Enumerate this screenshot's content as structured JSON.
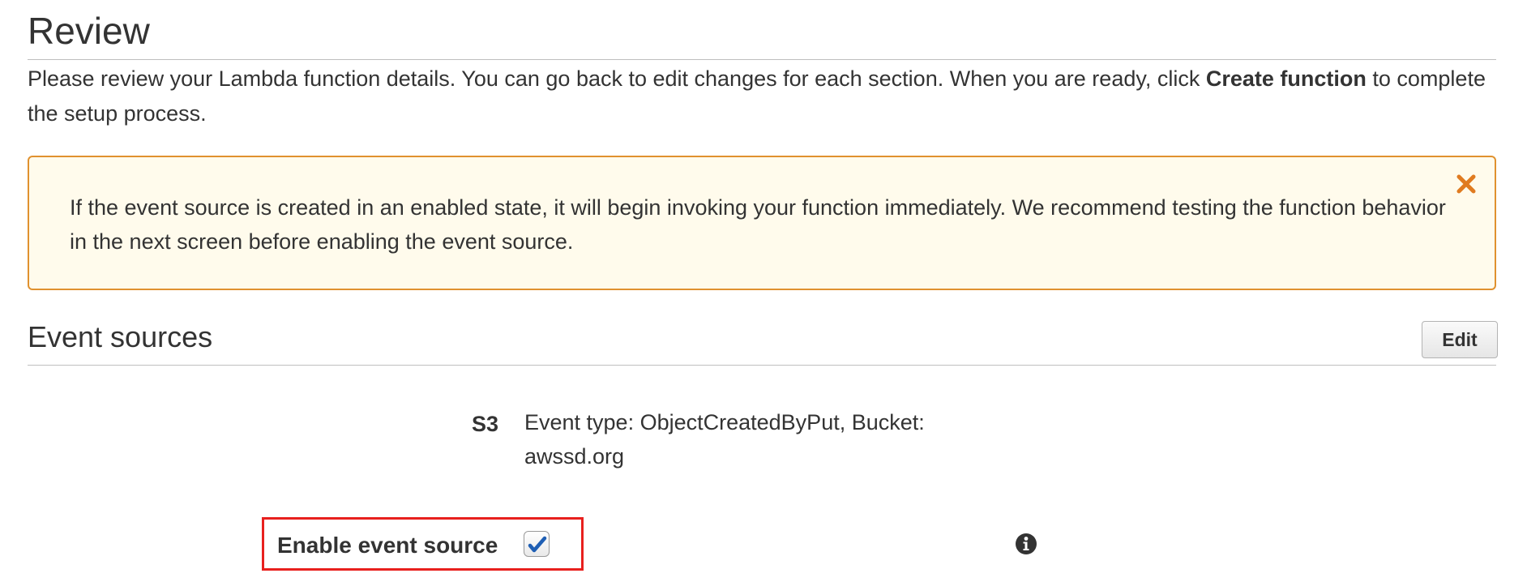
{
  "review": {
    "title": "Review",
    "intro_part1": "Please review your Lambda function details. You can go back to edit changes for each section. When you are ready, click ",
    "intro_bold": "Create function",
    "intro_part2": " to complete the setup process."
  },
  "alert": {
    "message": "If the event source is created in an enabled state, it will begin invoking your function immediately. We recommend testing the function behavior in the next screen before enabling the event source.",
    "close_icon": "close-icon",
    "border_color": "#e0912f",
    "background_color": "#fffbec",
    "icon_color": "#e07b20"
  },
  "event_sources": {
    "title": "Event sources",
    "edit_label": "Edit",
    "source_type": "S3",
    "source_description": "Event type: ObjectCreatedByPut, Bucket: awssd.org",
    "enable_label": "Enable event source",
    "enable_checked": true,
    "checkmark_color": "#1f5fb4",
    "info_icon": "info-icon",
    "highlight_color": "#e8201e"
  }
}
